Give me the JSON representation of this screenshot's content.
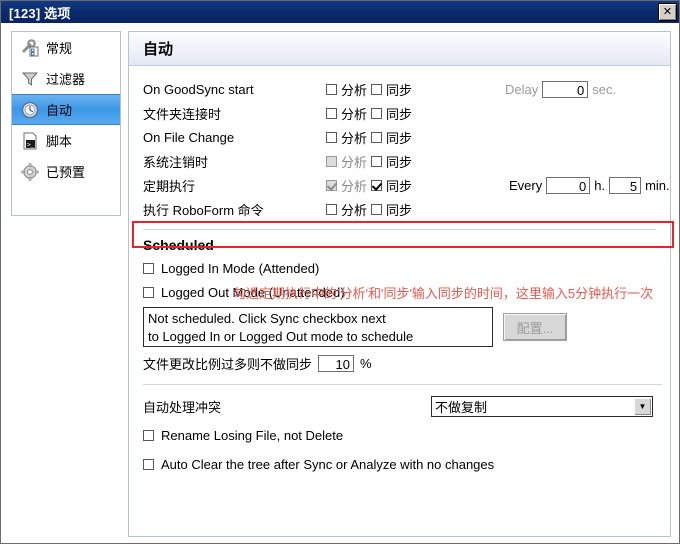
{
  "window": {
    "title": "[123] 选项",
    "close_label": "✕",
    "close_icon": "close-icon"
  },
  "sidebar": {
    "items": [
      {
        "label": "常规",
        "icon": "wrench-icon",
        "selected": false
      },
      {
        "label": "过滤器",
        "icon": "funnel-icon",
        "selected": false
      },
      {
        "label": "自动",
        "icon": "clock-icon",
        "selected": true
      },
      {
        "label": "脚本",
        "icon": "script-icon",
        "selected": false
      },
      {
        "label": "已预置",
        "icon": "gear-icon",
        "selected": false
      }
    ]
  },
  "panel": {
    "title": "自动",
    "analyze_label": "分析",
    "sync_label": "同步",
    "triggers": [
      {
        "label": "On GoodSync start",
        "analyze_checked": false,
        "analyze_disabled": false,
        "sync_checked": false,
        "sync_disabled": false
      },
      {
        "label": "文件夹连接时",
        "analyze_checked": false,
        "analyze_disabled": false,
        "sync_checked": false,
        "sync_disabled": false
      },
      {
        "label": "On File Change",
        "analyze_checked": false,
        "analyze_disabled": false,
        "sync_checked": false,
        "sync_disabled": false
      },
      {
        "label": "系统注销时",
        "analyze_checked": false,
        "analyze_disabled": true,
        "sync_checked": false,
        "sync_disabled": false
      },
      {
        "label": "定期执行",
        "analyze_checked": true,
        "analyze_disabled": true,
        "sync_checked": true,
        "sync_disabled": false
      },
      {
        "label": "执行 RoboForm 命令",
        "analyze_checked": false,
        "analyze_disabled": false,
        "sync_checked": false,
        "sync_disabled": false
      }
    ],
    "delay": {
      "label": "Delay",
      "value": "0",
      "unit": "sec."
    },
    "every": {
      "label": "Every",
      "hours_value": "0",
      "hours_unit": "h.",
      "minutes_value": "5",
      "minutes_unit": "min."
    },
    "annotation": "勾选定期执行中的'分析'和'同步'输入同步的时间，这里输入5分钟执行一次",
    "scheduled": {
      "title": "Scheduled",
      "logged_in_label": "Logged In Mode (Attended)",
      "logged_in_checked": false,
      "logged_out_label": "Logged Out Mode (Unattended)",
      "logged_out_checked": false,
      "status_line1": "Not scheduled. Click Sync checkbox next",
      "status_line2": "to Logged In or Logged Out mode to schedule",
      "configure_label": "配置..."
    },
    "change_limit": {
      "label": "文件更改比例过多则不做同步",
      "value": "10",
      "unit": "%"
    },
    "conflicts": {
      "label": "自动处理冲突",
      "selected": "不做复制",
      "arrow_icon": "chevron-down-icon"
    },
    "rename_losing": {
      "label": "Rename Losing File, not Delete",
      "checked": false
    },
    "auto_clear": {
      "label": "Auto Clear the tree after Sync or Analyze with no changes",
      "checked": false
    }
  },
  "colors": {
    "titlebar": "#0a2463",
    "selected_item": "#3b97e8",
    "annotation": "#e8594f",
    "highlight_box": "#ee2222"
  }
}
